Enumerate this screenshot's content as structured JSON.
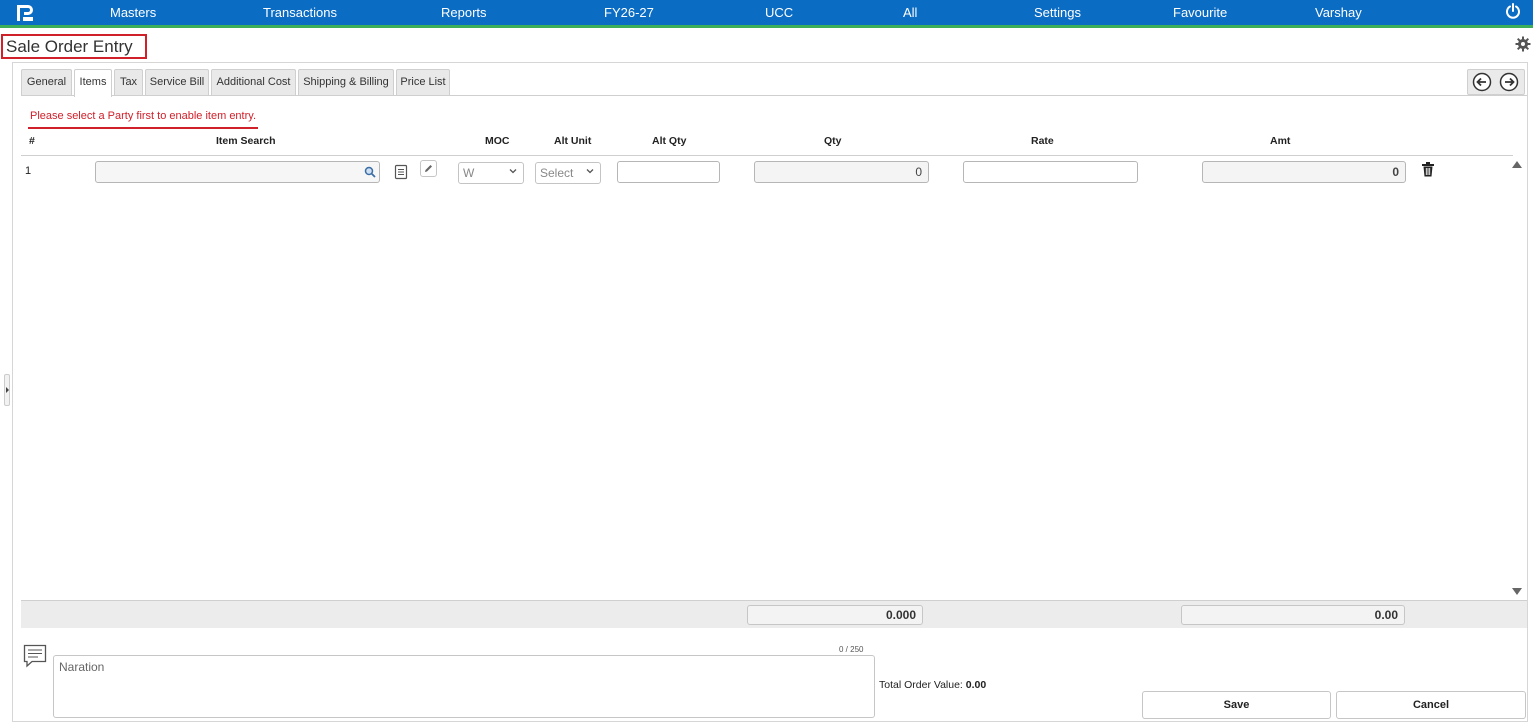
{
  "topbar": {
    "nav": [
      "Masters",
      "Transactions",
      "Reports",
      "FY26-27",
      "UCC",
      "All",
      "Settings",
      "Favourite",
      "Varshay"
    ]
  },
  "page": {
    "title": "Sale Order Entry"
  },
  "tabs": [
    "General",
    "Items",
    "Tax",
    "Service Bill",
    "Additional Cost",
    "Shipping & Billing",
    "Price List"
  ],
  "warning": "Please select a Party first to enable item entry.",
  "columns": {
    "hash": "#",
    "item_search": "Item Search",
    "moc": "MOC",
    "alt_unit": "Alt Unit",
    "alt_qty": "Alt Qty",
    "qty": "Qty",
    "rate": "Rate",
    "amt": "Amt"
  },
  "row": {
    "index": "1",
    "moc_value": "W",
    "alt_unit_value": "Select",
    "qty": "0",
    "amt": "0"
  },
  "totals": {
    "qty_total": "0.000",
    "amt_total": "0.00"
  },
  "naration": {
    "placeholder": "Naration",
    "char_count": "0 / 250"
  },
  "summary": {
    "label": "Total Order Value:",
    "value": "0.00"
  },
  "buttons": {
    "save": "Save",
    "cancel": "Cancel"
  },
  "colors": {
    "topbar": "#0b6cc4",
    "accent_green": "#3cae5a",
    "warning_red": "#d0202a"
  }
}
